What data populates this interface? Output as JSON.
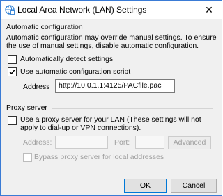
{
  "window": {
    "title": "Local Area Network (LAN) Settings",
    "close_glyph": "✕"
  },
  "auto_config": {
    "heading": "Automatic configuration",
    "description": "Automatic configuration may override manual settings.  To ensure the use of manual settings, disable automatic configuration.",
    "detect_label": "Automatically detect settings",
    "detect_checked": false,
    "script_label": "Use automatic configuration script",
    "script_checked": true,
    "address_label": "Address",
    "address_value": "http://10.0.1.1:4125/PACfile.pac"
  },
  "proxy": {
    "heading": "Proxy server",
    "use_proxy_label": "Use a proxy server for your LAN (These settings will not apply to dial-up or VPN connections).",
    "use_proxy_checked": false,
    "address_label": "Address:",
    "address_value": "",
    "port_label": "Port:",
    "port_value": "",
    "advanced_label": "Advanced",
    "bypass_label": "Bypass proxy server for local addresses",
    "bypass_checked": false
  },
  "buttons": {
    "ok_label": "OK",
    "cancel_label": "Cancel"
  },
  "colors": {
    "accent": "#0078d7",
    "globe_icon": "#2f7fd3"
  },
  "icons": {
    "title": "network-globe-icon",
    "close": "close-icon",
    "check": "checkmark-icon"
  }
}
